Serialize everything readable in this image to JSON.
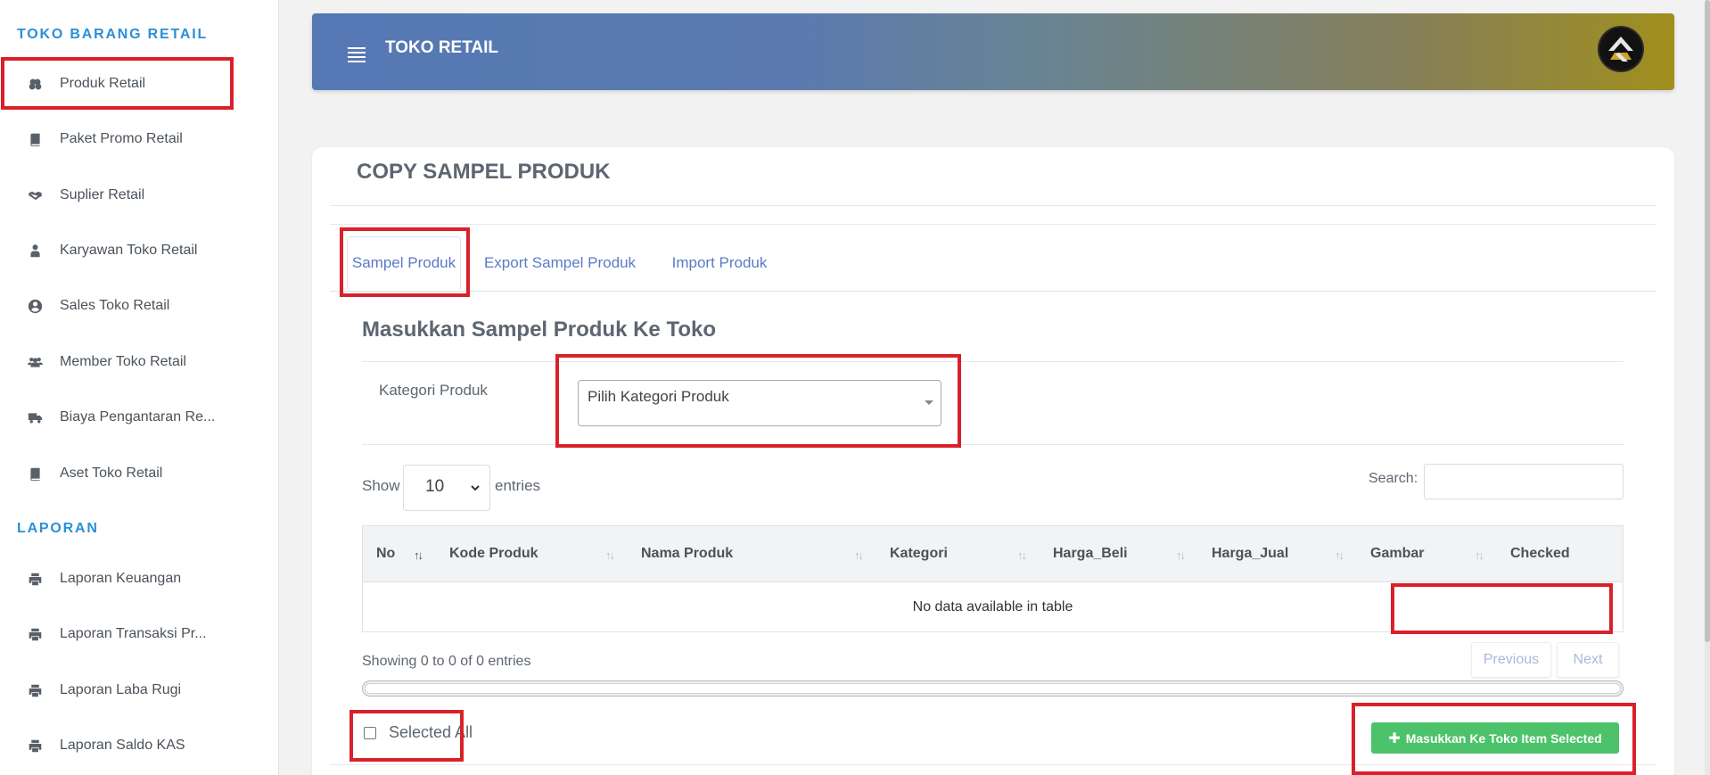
{
  "sidebar": {
    "section_main": "TOKO BARANG RETAIL",
    "items_main": [
      {
        "label": "Produk Retail",
        "icon": "cubes-icon"
      },
      {
        "label": "Paket Promo Retail",
        "icon": "book-icon"
      },
      {
        "label": "Suplier Retail",
        "icon": "handshake-icon"
      },
      {
        "label": "Karyawan Toko Retail",
        "icon": "user-tie-icon"
      },
      {
        "label": "Sales Toko Retail",
        "icon": "user-circle-icon"
      },
      {
        "label": "Member Toko Retail",
        "icon": "users-icon"
      },
      {
        "label": "Biaya Pengantaran Re...",
        "icon": "truck-icon"
      },
      {
        "label": "Aset Toko Retail",
        "icon": "book-icon"
      }
    ],
    "section_report": "LAPORAN",
    "items_report": [
      {
        "label": "Laporan Keuangan",
        "icon": "print-icon"
      },
      {
        "label": "Laporan Transaksi Pr...",
        "icon": "print-icon"
      },
      {
        "label": "Laporan Laba Rugi",
        "icon": "print-icon"
      },
      {
        "label": "Laporan Saldo KAS",
        "icon": "print-icon"
      }
    ]
  },
  "header": {
    "title": "TOKO RETAIL"
  },
  "main": {
    "page_title": "COPY SAMPEL PRODUK",
    "tabs": [
      {
        "label": "Sampel Produk",
        "active": true
      },
      {
        "label": "Export Sampel Produk",
        "active": false
      },
      {
        "label": "Import Produk",
        "active": false
      }
    ],
    "section_title": "Masukkan Sampel Produk Ke Toko",
    "kategori_label": "Kategori Produk",
    "kategori_value": "Pilih Kategori Produk",
    "show_label": "Show",
    "entries_value": "10",
    "entries_label": "entries",
    "search_label": "Search:",
    "table": {
      "columns": [
        "No",
        "Kode Produk",
        "Nama Produk",
        "Kategori",
        "Harga_Beli",
        "Harga_Jual",
        "Gambar",
        "Checked"
      ],
      "empty_text": "No data available in table"
    },
    "info_text": "Showing 0 to 0 of 0 entries",
    "prev_label": "Previous",
    "next_label": "Next",
    "select_all_label": "Selected All",
    "add_button_label": "Masukkan Ke Toko Item Selected"
  },
  "colors": {
    "accent": "#2a8fd8",
    "tab_link": "#5b7ac6",
    "success": "#4cc36a",
    "highlight": "#d9212a"
  }
}
